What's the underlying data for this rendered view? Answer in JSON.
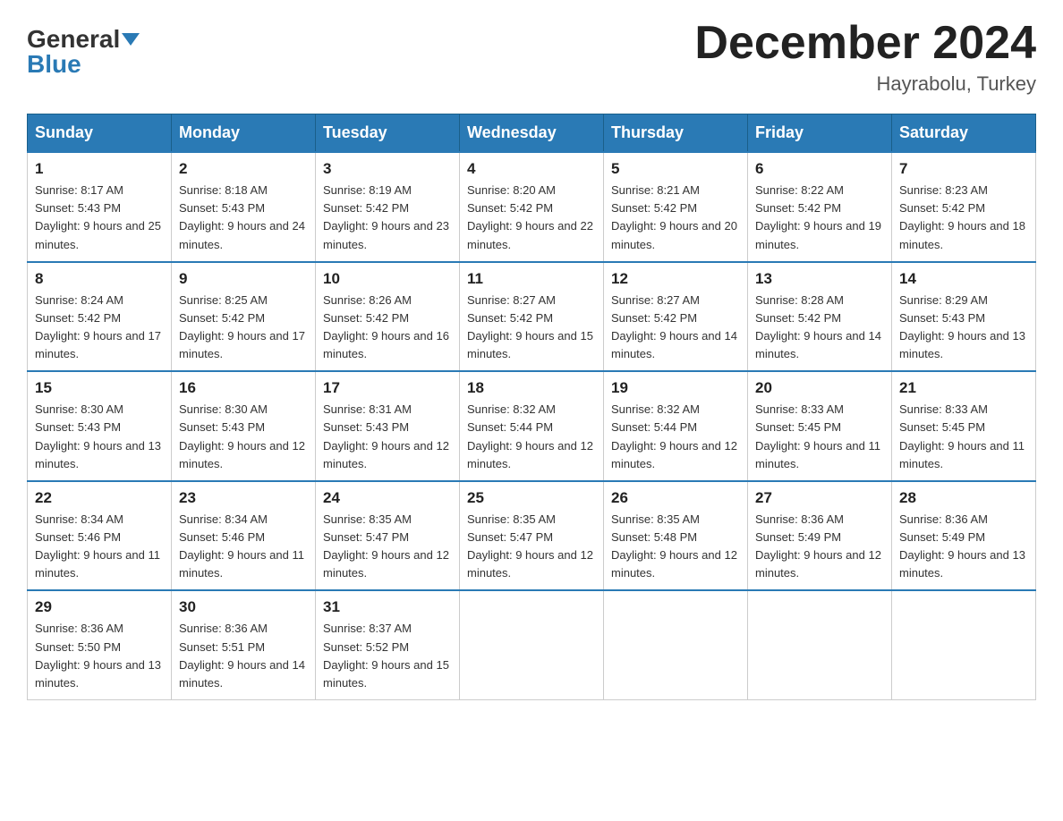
{
  "header": {
    "logo_general": "General",
    "logo_blue": "Blue",
    "month_title": "December 2024",
    "location": "Hayrabolu, Turkey"
  },
  "weekdays": [
    "Sunday",
    "Monday",
    "Tuesday",
    "Wednesday",
    "Thursday",
    "Friday",
    "Saturday"
  ],
  "weeks": [
    [
      {
        "day": "1",
        "sunrise": "8:17 AM",
        "sunset": "5:43 PM",
        "daylight": "9 hours and 25 minutes."
      },
      {
        "day": "2",
        "sunrise": "8:18 AM",
        "sunset": "5:43 PM",
        "daylight": "9 hours and 24 minutes."
      },
      {
        "day": "3",
        "sunrise": "8:19 AM",
        "sunset": "5:42 PM",
        "daylight": "9 hours and 23 minutes."
      },
      {
        "day": "4",
        "sunrise": "8:20 AM",
        "sunset": "5:42 PM",
        "daylight": "9 hours and 22 minutes."
      },
      {
        "day": "5",
        "sunrise": "8:21 AM",
        "sunset": "5:42 PM",
        "daylight": "9 hours and 20 minutes."
      },
      {
        "day": "6",
        "sunrise": "8:22 AM",
        "sunset": "5:42 PM",
        "daylight": "9 hours and 19 minutes."
      },
      {
        "day": "7",
        "sunrise": "8:23 AM",
        "sunset": "5:42 PM",
        "daylight": "9 hours and 18 minutes."
      }
    ],
    [
      {
        "day": "8",
        "sunrise": "8:24 AM",
        "sunset": "5:42 PM",
        "daylight": "9 hours and 17 minutes."
      },
      {
        "day": "9",
        "sunrise": "8:25 AM",
        "sunset": "5:42 PM",
        "daylight": "9 hours and 17 minutes."
      },
      {
        "day": "10",
        "sunrise": "8:26 AM",
        "sunset": "5:42 PM",
        "daylight": "9 hours and 16 minutes."
      },
      {
        "day": "11",
        "sunrise": "8:27 AM",
        "sunset": "5:42 PM",
        "daylight": "9 hours and 15 minutes."
      },
      {
        "day": "12",
        "sunrise": "8:27 AM",
        "sunset": "5:42 PM",
        "daylight": "9 hours and 14 minutes."
      },
      {
        "day": "13",
        "sunrise": "8:28 AM",
        "sunset": "5:42 PM",
        "daylight": "9 hours and 14 minutes."
      },
      {
        "day": "14",
        "sunrise": "8:29 AM",
        "sunset": "5:43 PM",
        "daylight": "9 hours and 13 minutes."
      }
    ],
    [
      {
        "day": "15",
        "sunrise": "8:30 AM",
        "sunset": "5:43 PM",
        "daylight": "9 hours and 13 minutes."
      },
      {
        "day": "16",
        "sunrise": "8:30 AM",
        "sunset": "5:43 PM",
        "daylight": "9 hours and 12 minutes."
      },
      {
        "day": "17",
        "sunrise": "8:31 AM",
        "sunset": "5:43 PM",
        "daylight": "9 hours and 12 minutes."
      },
      {
        "day": "18",
        "sunrise": "8:32 AM",
        "sunset": "5:44 PM",
        "daylight": "9 hours and 12 minutes."
      },
      {
        "day": "19",
        "sunrise": "8:32 AM",
        "sunset": "5:44 PM",
        "daylight": "9 hours and 12 minutes."
      },
      {
        "day": "20",
        "sunrise": "8:33 AM",
        "sunset": "5:45 PM",
        "daylight": "9 hours and 11 minutes."
      },
      {
        "day": "21",
        "sunrise": "8:33 AM",
        "sunset": "5:45 PM",
        "daylight": "9 hours and 11 minutes."
      }
    ],
    [
      {
        "day": "22",
        "sunrise": "8:34 AM",
        "sunset": "5:46 PM",
        "daylight": "9 hours and 11 minutes."
      },
      {
        "day": "23",
        "sunrise": "8:34 AM",
        "sunset": "5:46 PM",
        "daylight": "9 hours and 11 minutes."
      },
      {
        "day": "24",
        "sunrise": "8:35 AM",
        "sunset": "5:47 PM",
        "daylight": "9 hours and 12 minutes."
      },
      {
        "day": "25",
        "sunrise": "8:35 AM",
        "sunset": "5:47 PM",
        "daylight": "9 hours and 12 minutes."
      },
      {
        "day": "26",
        "sunrise": "8:35 AM",
        "sunset": "5:48 PM",
        "daylight": "9 hours and 12 minutes."
      },
      {
        "day": "27",
        "sunrise": "8:36 AM",
        "sunset": "5:49 PM",
        "daylight": "9 hours and 12 minutes."
      },
      {
        "day": "28",
        "sunrise": "8:36 AM",
        "sunset": "5:49 PM",
        "daylight": "9 hours and 13 minutes."
      }
    ],
    [
      {
        "day": "29",
        "sunrise": "8:36 AM",
        "sunset": "5:50 PM",
        "daylight": "9 hours and 13 minutes."
      },
      {
        "day": "30",
        "sunrise": "8:36 AM",
        "sunset": "5:51 PM",
        "daylight": "9 hours and 14 minutes."
      },
      {
        "day": "31",
        "sunrise": "8:37 AM",
        "sunset": "5:52 PM",
        "daylight": "9 hours and 15 minutes."
      },
      null,
      null,
      null,
      null
    ]
  ]
}
